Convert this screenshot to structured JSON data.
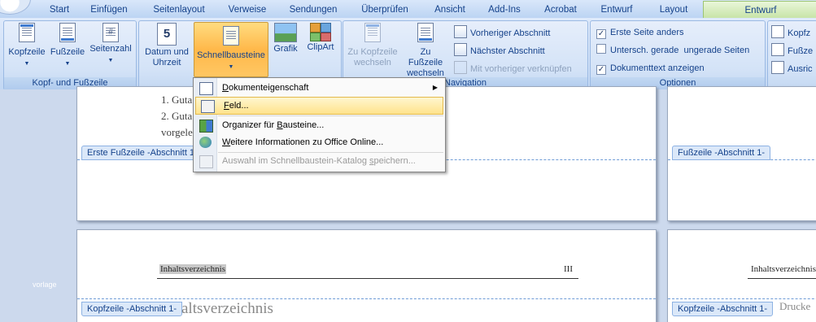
{
  "tabs": [
    "Start",
    "Einfügen",
    "Seitenlayout",
    "Verweise",
    "Sendungen",
    "Überprüfen",
    "Ansicht",
    "Add-Ins",
    "Acrobat",
    "Entwurf",
    "Layout"
  ],
  "context_tab": "Entwurf",
  "groups": {
    "kopf_fuss": {
      "label": "Kopf- und Fußzeile",
      "kopfzeile": "Kopfzeile",
      "fusszeile": "Fußzeile",
      "seitenzahl": "Seitenzahl"
    },
    "einfuegen": {
      "datum": "Datum und Uhrzeit",
      "schnellbausteine": "Schnellbausteine",
      "grafik": "Grafik",
      "clipart": "ClipArt",
      "date_icon_number": "5"
    },
    "navigation": {
      "label": "Navigation",
      "zu_kopfzeile": "Zu Kopfzeile wechseln",
      "zu_fusszeile": "Zu Fußzeile wechseln",
      "vorheriger": "Vorheriger Abschnitt",
      "naechster": "Nächster Abschnitt",
      "verknuepfen": "Mit vorheriger verknüpfen"
    },
    "optionen": {
      "label": "Optionen",
      "erste_seite": "Erste Seite anders",
      "untersch": "Untersch. gerade  ungerade Seiten",
      "dokumenttext": "Dokumenttext anzeigen",
      "erste_seite_checked": true,
      "untersch_checked": false,
      "dokumenttext_checked": true
    },
    "position": {
      "kopf": "Kopfz",
      "fuss": "Fußze",
      "ausr": "Ausric"
    }
  },
  "menu": {
    "items": [
      {
        "pre": "",
        "u": "D",
        "post": "okumenteigenschaft"
      },
      {
        "pre": "",
        "u": "F",
        "post": "eld..."
      },
      {
        "pre": "Organizer für ",
        "u": "B",
        "post": "austeine..."
      },
      {
        "pre": "",
        "u": "W",
        "post": "eitere Informationen zu Office Online..."
      },
      {
        "pre": "Auswahl im Schnellbaustein-Katalog ",
        "u": "s",
        "post": "peichern..."
      }
    ]
  },
  "document": {
    "list1": "1. Guta",
    "list2": "2. Guta",
    "list3": "vorgele",
    "erste_fusszeile_tag": "Erste Fußzeile -Abschnitt 1-",
    "fusszeile_tag": "Fußzeile -Abschnitt 1-",
    "kopfzeile_tag_left": "Kopfzeile -Abschnitt 1-",
    "kopfzeile_tag_right": "Kopfzeile -Abschnitt 1-",
    "inhalt_left": "Inhaltsverzeichnis",
    "page_num": "III",
    "inhalt_right": "Inhaltsverzeichnis",
    "heading": "altsverzeichnis",
    "druck": "Drucke",
    "left_label": "vorlage"
  }
}
